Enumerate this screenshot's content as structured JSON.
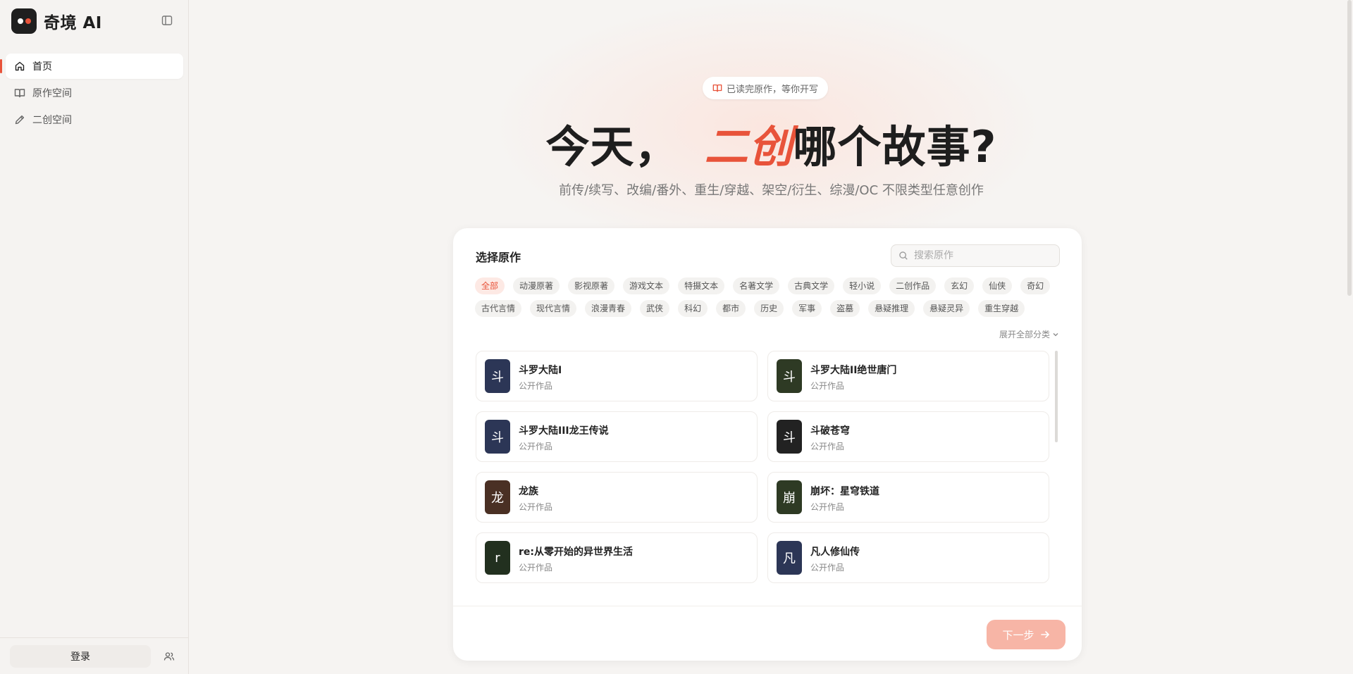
{
  "app": {
    "name": "奇境 AI"
  },
  "sidebar": {
    "items": [
      {
        "label": "首页",
        "icon": "home-icon",
        "active": true
      },
      {
        "label": "原作空间",
        "icon": "book-icon",
        "active": false
      },
      {
        "label": "二创空间",
        "icon": "pen-icon",
        "active": false
      }
    ],
    "login_label": "登录"
  },
  "hero": {
    "pill_text": "已读完原作，等你开写",
    "title_before": "今天，",
    "title_accent": "二创",
    "title_after": "哪个故事?",
    "subtitle": "前传/续写、改编/番外、重生/穿越、架空/衍生、综漫/OC 不限类型任意创作"
  },
  "picker": {
    "title": "选择原作",
    "search_placeholder": "搜索原作",
    "tags_row1": [
      "全部",
      "动漫原著",
      "影视原著",
      "游戏文本",
      "特摄文本",
      "名著文学",
      "古典文学",
      "轻小说",
      "二创作品",
      "玄幻",
      "仙侠",
      "奇幻"
    ],
    "tags_row2": [
      "古代言情",
      "现代言情",
      "浪漫青春",
      "武侠",
      "科幻",
      "都市",
      "历史",
      "军事",
      "盗墓",
      "悬疑推理",
      "悬疑灵异",
      "重生穿越"
    ],
    "active_tag": "全部",
    "expand_label": "展开全部分类",
    "works": [
      {
        "cover": "斗",
        "title": "斗罗大陆I",
        "sub": "公开作品",
        "color": "#2c3656"
      },
      {
        "cover": "斗",
        "title": "斗罗大陆II绝世唐门",
        "sub": "公开作品",
        "color": "#2e3a24"
      },
      {
        "cover": "斗",
        "title": "斗罗大陆III龙王传说",
        "sub": "公开作品",
        "color": "#2c3656"
      },
      {
        "cover": "斗",
        "title": "斗破苍穹",
        "sub": "公开作品",
        "color": "#222222"
      },
      {
        "cover": "龙",
        "title": "龙族",
        "sub": "公开作品",
        "color": "#4a3024"
      },
      {
        "cover": "崩",
        "title": "崩坏：星穹铁道",
        "sub": "公开作品",
        "color": "#2e3a24"
      },
      {
        "cover": "r",
        "title": "re:从零开始的异世界生活",
        "sub": "公开作品",
        "color": "#22301f"
      },
      {
        "cover": "凡",
        "title": "凡人修仙传",
        "sub": "公开作品",
        "color": "#2c3656"
      }
    ],
    "next_label": "下一步"
  },
  "colors": {
    "accent": "#e8533a",
    "next_button": "#f7b5a6"
  }
}
